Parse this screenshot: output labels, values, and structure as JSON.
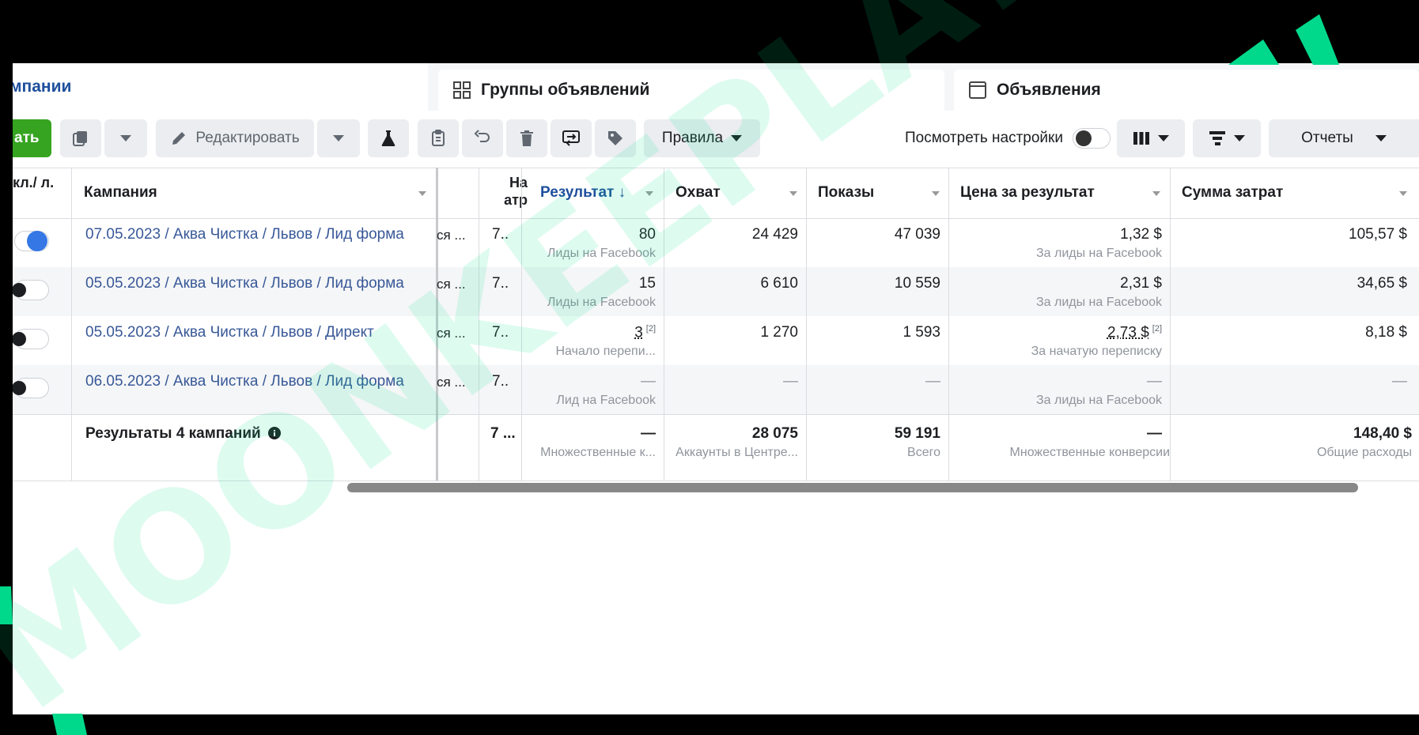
{
  "tabs": {
    "campaigns": "мпании",
    "adsets": "Группы объявлений",
    "ads": "Объявления"
  },
  "toolbar": {
    "create_label": "ать",
    "edit_label": "Редактировать",
    "rules_label": "Правила",
    "view_settings_label": "Посмотреть настройки",
    "reports_label": "Отчеты"
  },
  "table": {
    "headers": {
      "onoff": "кл./ л.",
      "campaign": "Кампания",
      "attr": "На атр",
      "result": "Результат ↓",
      "reach": "Охват",
      "impressions": "Показы",
      "cost": "Цена за результат",
      "spend": "Сумма затрат"
    },
    "rows": [
      {
        "name": "07.05.2023 / Аква Чистка / Львов / Лид форма",
        "delivery": "ся ...",
        "attr": "7..",
        "result": "80",
        "result_sub": "Лиды на Facebook",
        "reach": "24 429",
        "impressions": "47 039",
        "cost": "1,32 $",
        "cost_sub": "За лиды на Facebook",
        "spend": "105,57 $",
        "active": true
      },
      {
        "name": "05.05.2023 / Аква Чистка / Львов / Лид форма",
        "delivery": "ся ...",
        "attr": "7..",
        "result": "15",
        "result_sub": "Лиды на Facebook",
        "reach": "6 610",
        "impressions": "10 559",
        "cost": "2,31 $",
        "cost_sub": "За лиды на Facebook",
        "spend": "34,65 $",
        "active": false
      },
      {
        "name": "05.05.2023 / Аква Чистка / Львов / Директ",
        "delivery": "ся ...",
        "attr": "7..",
        "result": "3",
        "result_note": "[2]",
        "result_sub": "Начало перепи...",
        "reach": "1 270",
        "impressions": "1 593",
        "cost": "2,73 $",
        "cost_note": "[2]",
        "cost_sub": "За начатую переписку",
        "spend": "8,18 $",
        "active": false
      },
      {
        "name": "06.05.2023 / Аква Чистка / Львов / Лид форма",
        "delivery": "ся ...",
        "attr": "7..",
        "result": "—",
        "result_sub": "Лид на Facebook",
        "reach": "—",
        "impressions": "—",
        "cost": "—",
        "cost_sub": "За лиды на Facebook",
        "spend": "—",
        "active": false
      }
    ],
    "totals": {
      "label": "Результаты 4 кампаний",
      "attr": "7 ...",
      "result": "—",
      "result_sub": "Множественные к...",
      "reach": "28 075",
      "reach_sub": "Аккаунты в Центре...",
      "impressions": "59 191",
      "impressions_sub": "Всего",
      "cost": "—",
      "cost_sub": "Множественные конверсии",
      "spend": "148,40 $",
      "spend_sub": "Общие расходы"
    }
  },
  "watermark": "MOONKEEPLAY DIGITAL",
  "colors": {
    "link": "#385898",
    "accent": "#1d4f9c",
    "create_green": "#36a420",
    "toggle_on": "#3578e5",
    "watermark": "#00e08a"
  }
}
